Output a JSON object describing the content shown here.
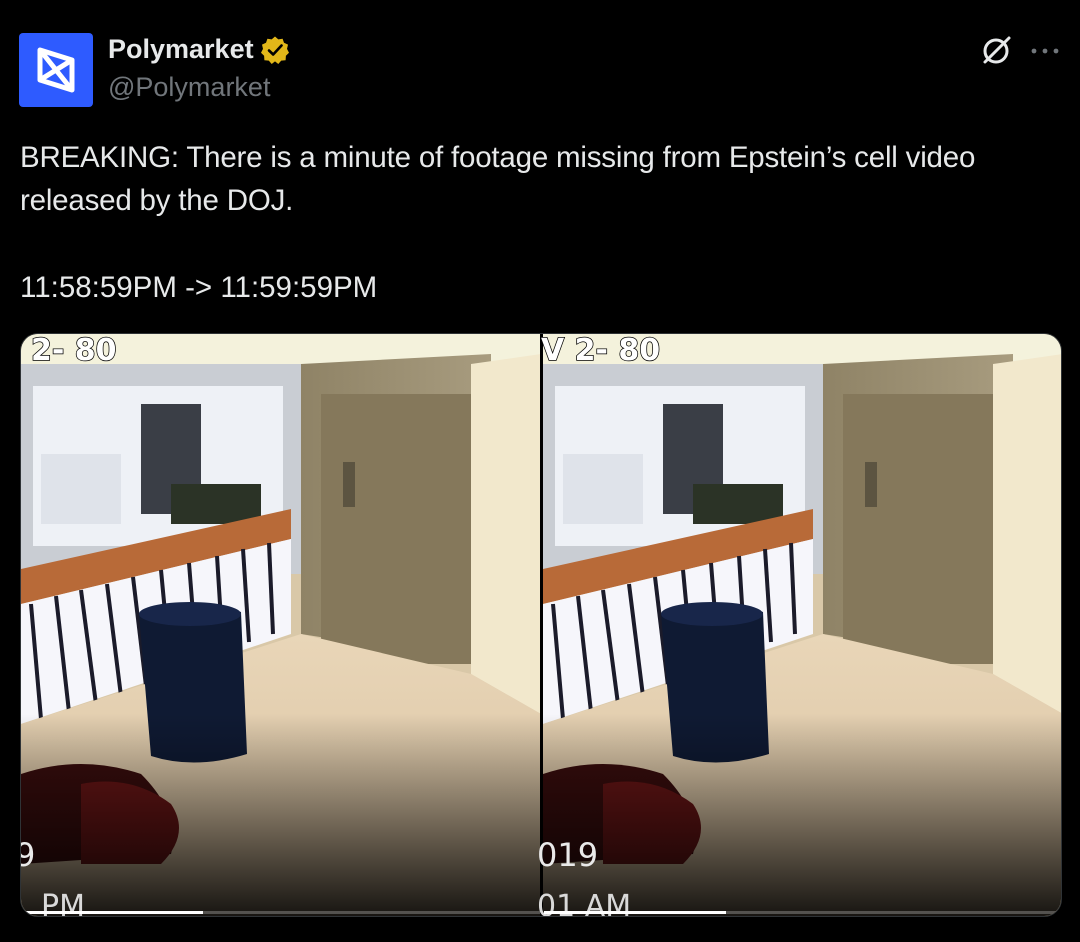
{
  "author": {
    "display_name": "Polymarket",
    "handle": "@Polymarket",
    "verified": true,
    "verified_color": "#e2b719",
    "avatar_color": "#2e5bff",
    "avatar_icon": "polymarket-logo-icon"
  },
  "actions": {
    "grok_icon": "grok-icon",
    "more_icon": "more-icon"
  },
  "tweet": {
    "text_line": "BREAKING: There is a minute of footage missing from Epstein’s cell video released by the DOJ.",
    "timestamp_line": "11:58:59PM -> 11:59:59PM"
  },
  "media": {
    "left_frame": {
      "overlay_top": "2- 80",
      "overlay_mid": "9",
      "overlay_bottom": "PM",
      "progress": 0.35
    },
    "right_frame": {
      "overlay_top": "V 2- 80",
      "overlay_mid": "019",
      "overlay_bottom": "01 AM",
      "progress": 0.35
    }
  }
}
